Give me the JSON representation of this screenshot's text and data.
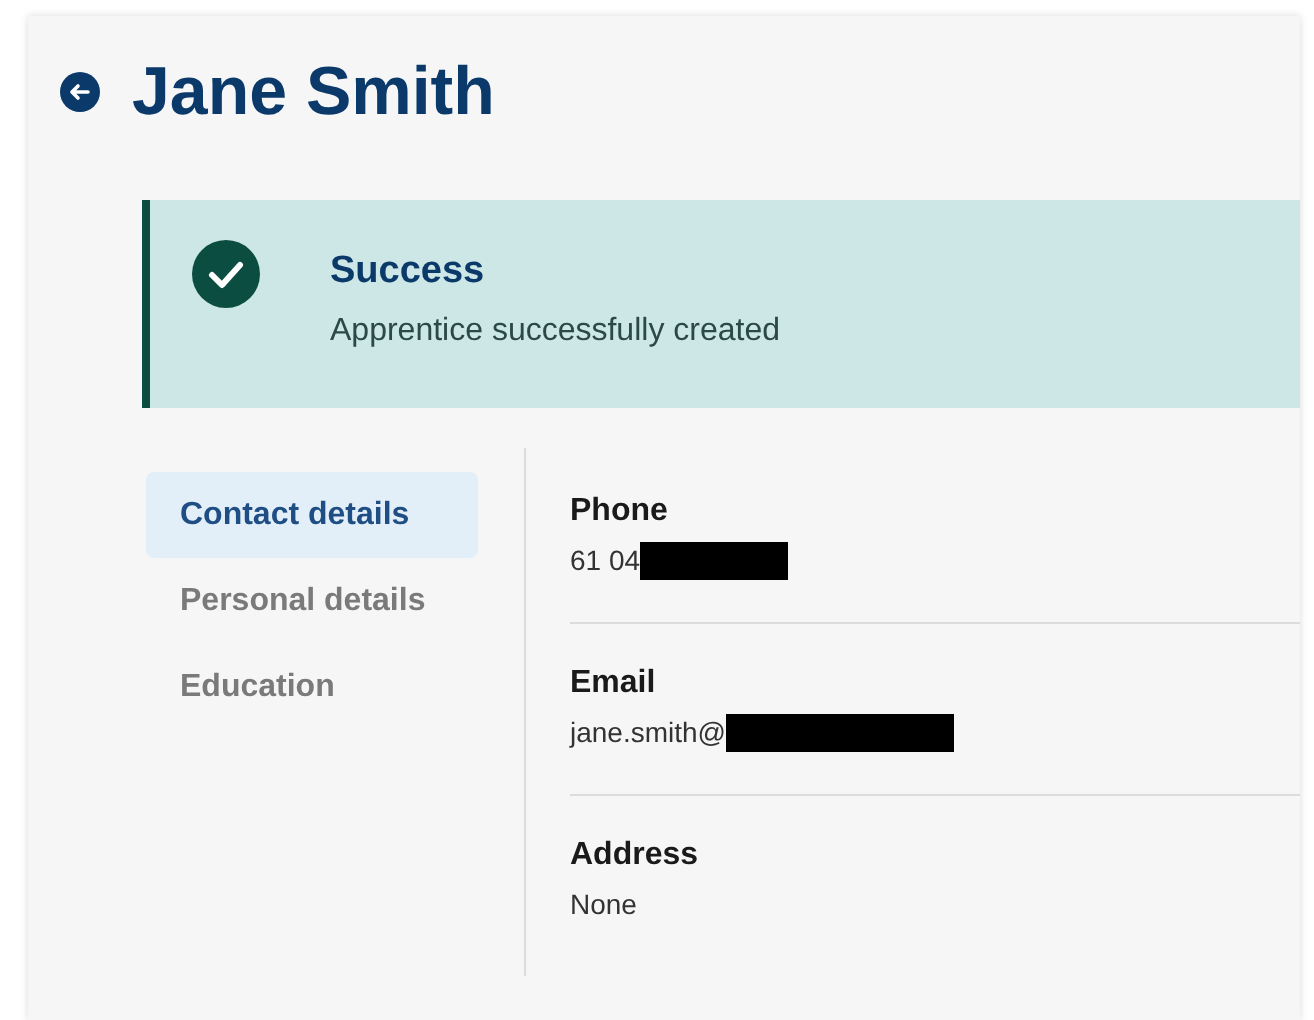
{
  "title": "Jane Smith",
  "alert": {
    "kind": "success",
    "heading": "Success",
    "message": "Apprentice successfully created"
  },
  "nav": [
    {
      "label": "Contact details",
      "selected": true
    },
    {
      "label": "Personal details",
      "selected": false
    },
    {
      "label": "Education",
      "selected": false
    }
  ],
  "fields": [
    {
      "label": "Phone",
      "value": "61 04",
      "redacted": true
    },
    {
      "label": "Email",
      "value": "jane.smith@",
      "redacted": true
    },
    {
      "label": "Address",
      "value": "None",
      "redacted": false
    }
  ]
}
